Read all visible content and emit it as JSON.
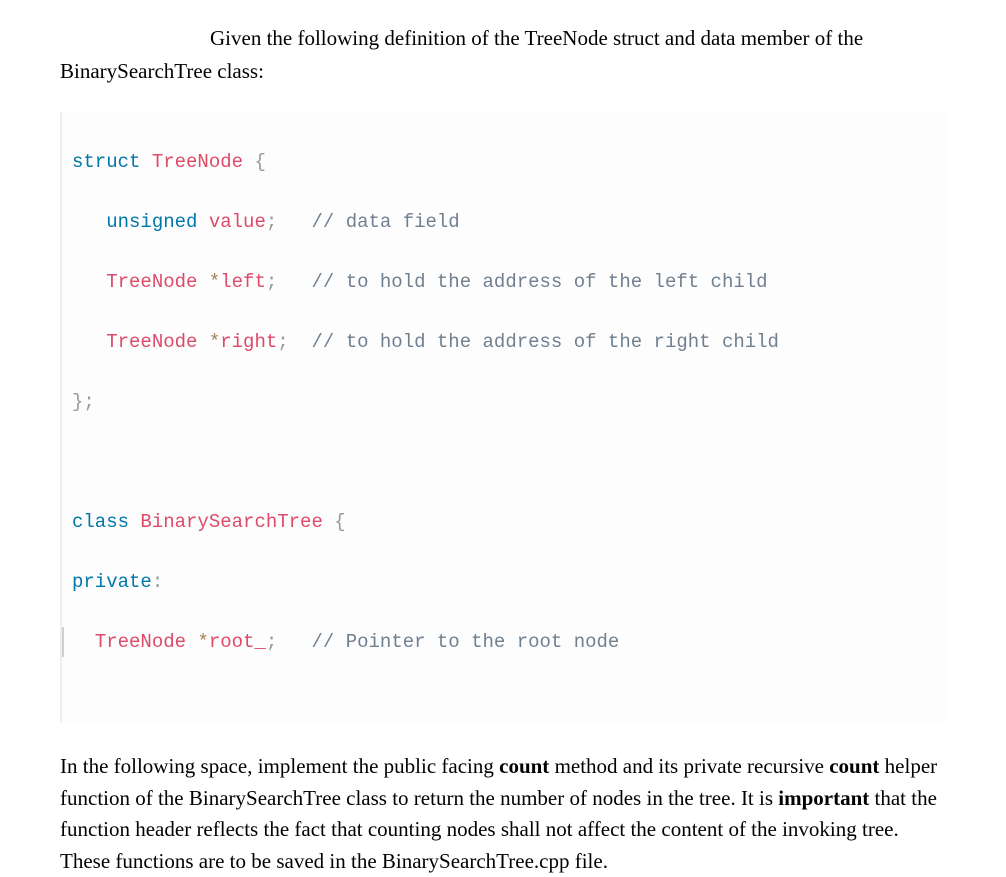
{
  "intro": {
    "line1": "Given the following definition of the TreeNode struct and data member of the",
    "line2": "BinarySearchTree class:"
  },
  "code": {
    "l1": {
      "kw": "struct",
      "name": "TreeNode",
      "brace": "{"
    },
    "l2": {
      "type": "unsigned",
      "field": "value",
      "semi": ";",
      "cmt": "// data field"
    },
    "l3": {
      "typeName": "TreeNode",
      "star": "*",
      "field": "left",
      "semi": ";",
      "cmt": "// to hold the address of the left child"
    },
    "l4": {
      "typeName": "TreeNode",
      "star": "*",
      "field": "right",
      "semi": ";",
      "cmt": "// to hold the address of the right child"
    },
    "l5": {
      "close": "};"
    },
    "l7": {
      "kw": "class",
      "name": "BinarySearchTree",
      "brace": "{"
    },
    "l8": {
      "kw": "private",
      "colon": ":"
    },
    "l9": {
      "typeName": "TreeNode",
      "star": "*",
      "field": "root_",
      "semi": ";",
      "cmt": "// Pointer to the root node"
    }
  },
  "question": {
    "p1a": "In the following space, implement the public facing ",
    "p1b": "count",
    "p1c": " method and its private recursive ",
    "p2a": "count",
    "p2b": " helper function of the BinarySearchTree class to return the number of nodes in the tree. It is ",
    "p2c": "important",
    "p2d": " that the function header reflects the fact that counting nodes shall not affect the content of the invoking tree. These functions are to be saved in the BinarySearchTree.cpp file."
  }
}
